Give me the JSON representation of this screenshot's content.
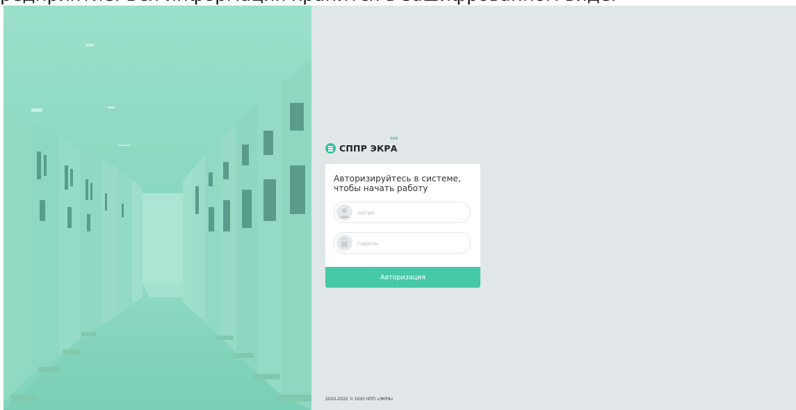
{
  "top_clipped_text": "редприятие. Вся информация хранится в зашифрованном виде.",
  "brand": {
    "name": "СППР ЭКРА",
    "superscript": "360",
    "logo_icon": "ekra-logo-icon",
    "accent_color": "#33c29d"
  },
  "login_card": {
    "title": "Авторизируйтесь в системе, чтобы начать работу",
    "login_field": {
      "placeholder": "логин",
      "value": "",
      "icon": "user-icon"
    },
    "password_field": {
      "placeholder": "пароль",
      "value": "",
      "icon": "lock-icon"
    },
    "submit_label": "Авторизация",
    "button_color": "#46c9a5"
  },
  "footer": {
    "copyright": "2020-2022 © ООО НПП «ЭКРА»"
  },
  "photo": {
    "description_icon": "server-room-corridor-photo",
    "overlay_color": "#6fd3b8"
  }
}
